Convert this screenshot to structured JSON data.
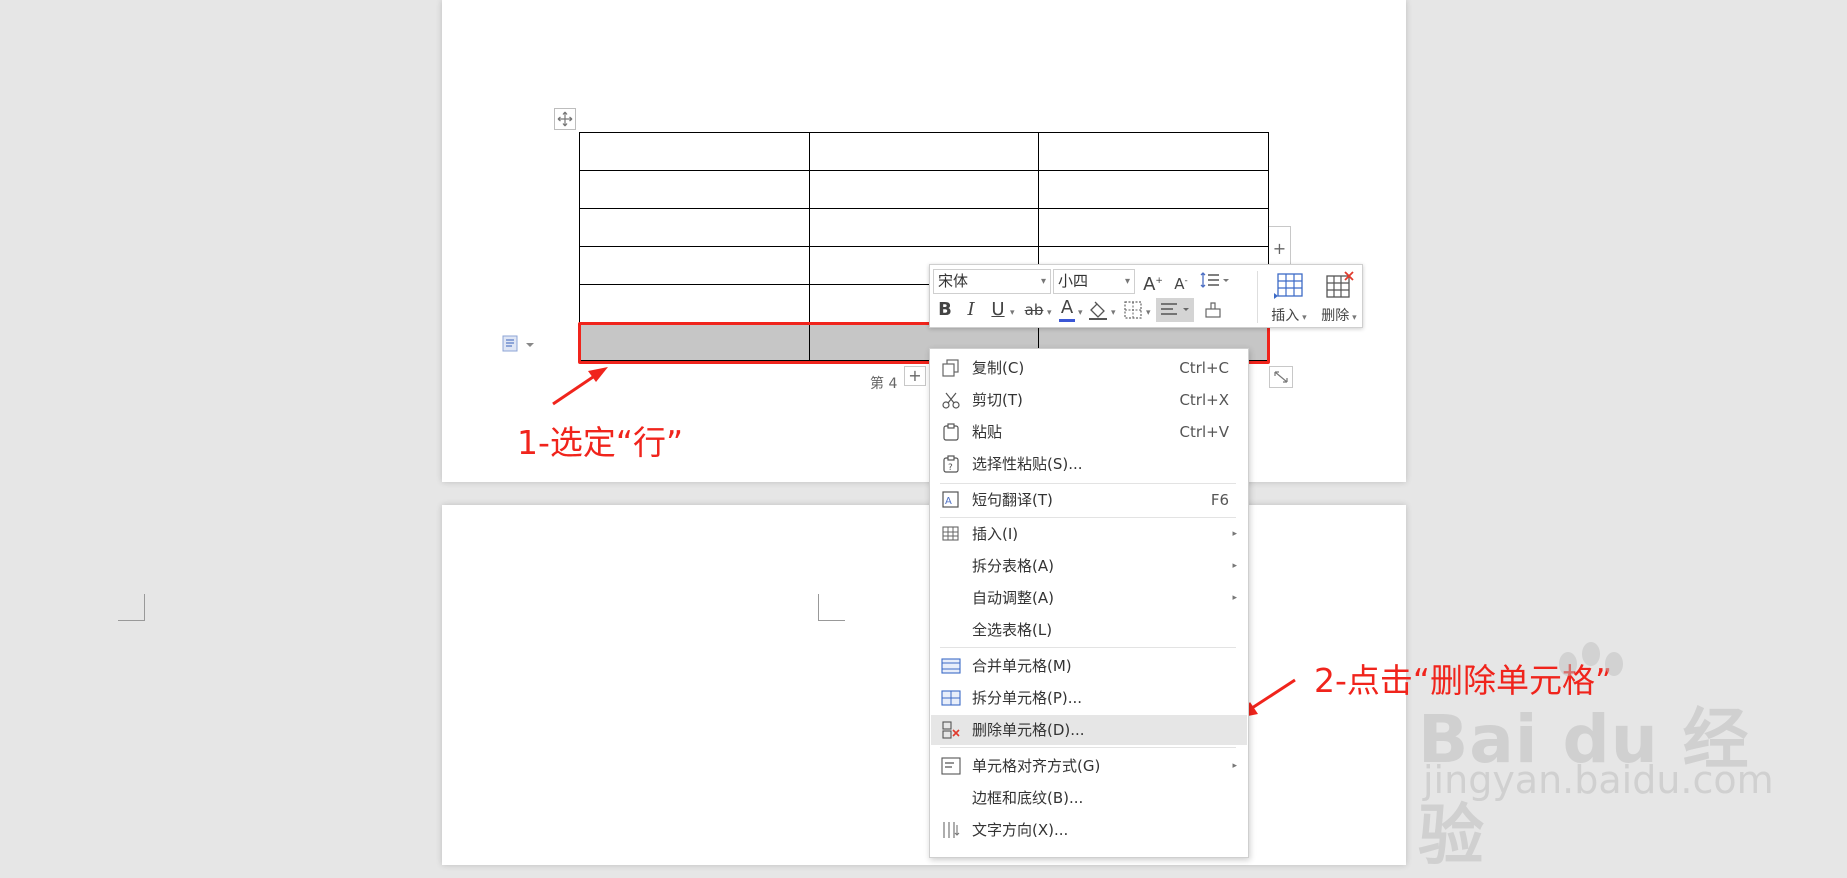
{
  "document": {
    "table": {
      "rows": 6,
      "cols": 3,
      "selected_row": 6
    },
    "page_number": "第 4",
    "add_row_icon": "plus-icon",
    "add_column_icon": "plus-icon"
  },
  "annotations": {
    "step1": "1-选定“行”",
    "step2": "2-点击“删除单元格”",
    "color": "#f0241c"
  },
  "mini_toolbar": {
    "font_name": "宋体",
    "font_size": "小四",
    "grow_font": "A",
    "shrink_font": "A",
    "bold": "B",
    "italic": "I",
    "underline": "U",
    "strike": "ab",
    "font_color": "A",
    "insert_label": "插入",
    "delete_label": "删除",
    "font_color_hex": "#3b57d6"
  },
  "context_menu": {
    "items": [
      {
        "label": "复制(C)",
        "shortcut": "Ctrl+C",
        "icon": "copy-icon"
      },
      {
        "label": "剪切(T)",
        "shortcut": "Ctrl+X",
        "icon": "scissors-icon"
      },
      {
        "label": "粘贴",
        "shortcut": "Ctrl+V",
        "icon": "paste-icon"
      },
      {
        "label": "选择性粘贴(S)...",
        "shortcut": "",
        "icon": "paste-special-icon"
      },
      {
        "label": "短句翻译(T)",
        "shortcut": "F6",
        "icon": "translate-icon"
      },
      {
        "label": "插入(I)",
        "shortcut": "",
        "icon": "table-insert-icon"
      },
      {
        "label": "拆分表格(A)",
        "shortcut": "",
        "icon": ""
      },
      {
        "label": "自动调整(A)",
        "shortcut": "",
        "icon": ""
      },
      {
        "label": "全选表格(L)",
        "shortcut": "",
        "icon": ""
      },
      {
        "label": "合并单元格(M)",
        "shortcut": "",
        "icon": "merge-cells-icon"
      },
      {
        "label": "拆分单元格(P)...",
        "shortcut": "",
        "icon": "split-cells-icon"
      },
      {
        "label": "删除单元格(D)...",
        "shortcut": "",
        "icon": "delete-cells-icon"
      },
      {
        "label": "单元格对齐方式(G)",
        "shortcut": "",
        "icon": "cell-align-icon"
      },
      {
        "label": "边框和底纹(B)...",
        "shortcut": "",
        "icon": ""
      },
      {
        "label": "文字方向(X)...",
        "shortcut": "",
        "icon": "text-direction-icon"
      }
    ],
    "highlighted": "删除单元格(D)..."
  },
  "watermark": {
    "logo": "Bai du 经验",
    "url": "jingyan.baidu.com"
  }
}
